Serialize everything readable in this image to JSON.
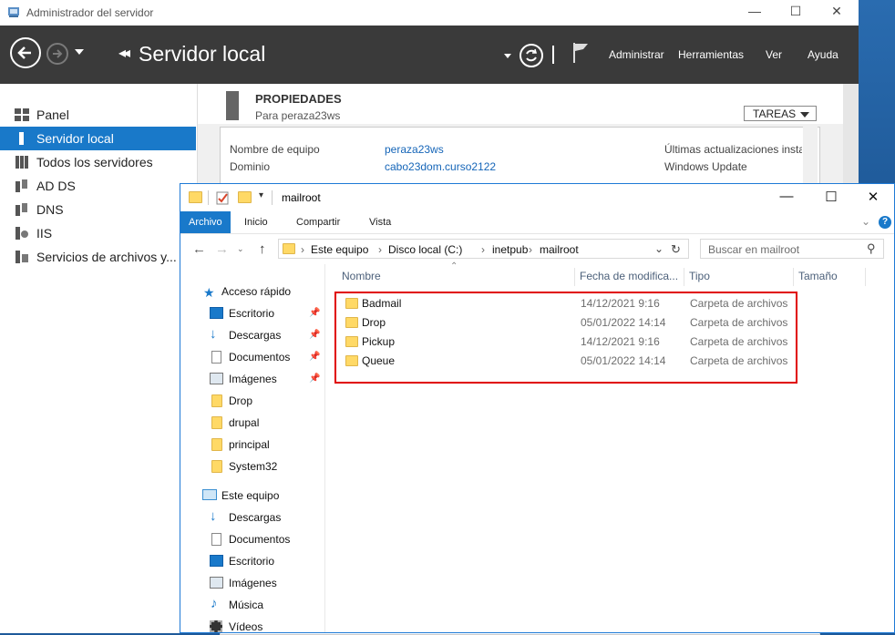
{
  "server_manager": {
    "window_title": "Administrador del servidor",
    "breadcrumb_title": "Servidor local",
    "menu": [
      "Administrar",
      "Herramientas",
      "Ver",
      "Ayuda"
    ],
    "sidebar": [
      {
        "label": "Panel",
        "icon": "dashboard-icon",
        "selected": false
      },
      {
        "label": "Servidor local",
        "icon": "server-icon",
        "selected": true
      },
      {
        "label": "Todos los servidores",
        "icon": "servers-icon",
        "selected": false
      },
      {
        "label": "AD DS",
        "icon": "ad-ds-icon",
        "selected": false
      },
      {
        "label": "DNS",
        "icon": "dns-icon",
        "selected": false
      },
      {
        "label": "IIS",
        "icon": "iis-icon",
        "selected": false
      },
      {
        "label": "Servicios de archivos y...",
        "icon": "file-services-icon",
        "selected": false
      }
    ],
    "properties": {
      "title": "PROPIEDADES",
      "subtitle": "Para peraza23ws",
      "tasks_label": "TAREAS",
      "rows": [
        {
          "label": "Nombre de equipo",
          "value": "peraza23ws"
        },
        {
          "label": "Dominio",
          "value": "cabo23dom.curso2122"
        }
      ],
      "right_rows": [
        {
          "label": "Últimas actualizaciones insta"
        },
        {
          "label": "Windows Update"
        }
      ]
    }
  },
  "explorer": {
    "window_title": "mailroot",
    "ribbon_tabs": [
      "Archivo",
      "Inicio",
      "Compartir",
      "Vista"
    ],
    "breadcrumb": [
      "Este equipo",
      "Disco local (C:)",
      "inetpub",
      "mailroot"
    ],
    "search_placeholder": "Buscar en mailroot",
    "columns": {
      "name": "Nombre",
      "date": "Fecha de modifica...",
      "type": "Tipo",
      "size": "Tamaño"
    },
    "files": [
      {
        "name": "Badmail",
        "date": "14/12/2021 9:16",
        "type": "Carpeta de archivos"
      },
      {
        "name": "Drop",
        "date": "05/01/2022 14:14",
        "type": "Carpeta de archivos"
      },
      {
        "name": "Pickup",
        "date": "14/12/2021 9:16",
        "type": "Carpeta de archivos"
      },
      {
        "name": "Queue",
        "date": "05/01/2022 14:14",
        "type": "Carpeta de archivos"
      }
    ],
    "nav": {
      "quick_access": {
        "label": "Acceso rápido",
        "items": [
          {
            "label": "Escritorio",
            "icon": "desktop-icon",
            "pinned": true
          },
          {
            "label": "Descargas",
            "icon": "downloads-icon",
            "pinned": true
          },
          {
            "label": "Documentos",
            "icon": "documents-icon",
            "pinned": true
          },
          {
            "label": "Imágenes",
            "icon": "pictures-icon",
            "pinned": true
          },
          {
            "label": "Drop",
            "icon": "folder-icon",
            "pinned": false
          },
          {
            "label": "drupal",
            "icon": "folder-icon",
            "pinned": false
          },
          {
            "label": "principal",
            "icon": "folder-icon",
            "pinned": false
          },
          {
            "label": "System32",
            "icon": "folder-icon",
            "pinned": false
          }
        ]
      },
      "this_pc": {
        "label": "Este equipo",
        "items": [
          {
            "label": "Descargas",
            "icon": "downloads-icon"
          },
          {
            "label": "Documentos",
            "icon": "documents-icon"
          },
          {
            "label": "Escritorio",
            "icon": "desktop-icon"
          },
          {
            "label": "Imágenes",
            "icon": "pictures-icon"
          },
          {
            "label": "Música",
            "icon": "music-icon"
          },
          {
            "label": "Vídeos",
            "icon": "videos-icon"
          }
        ]
      }
    },
    "highlight_color": "#e00000"
  }
}
